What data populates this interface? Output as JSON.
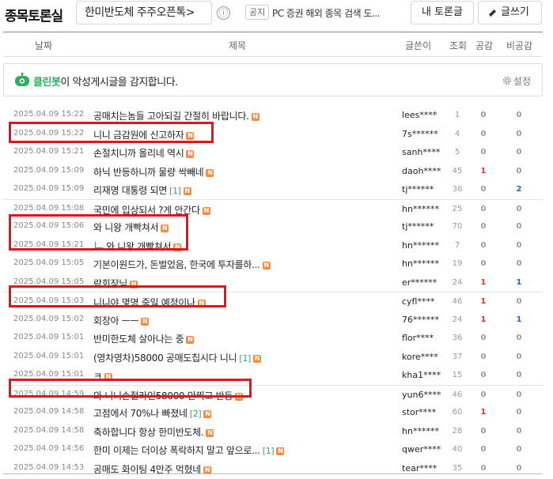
{
  "header": {
    "board_title": "종목토론실",
    "stock_name": "한미반도체 주주오픈톡>",
    "info_icon": "ⓘ",
    "notice_badge": "공지",
    "notice_text": "PC 증권 해외 종목 검색 도...",
    "my_board_button": "내 토론글",
    "write_button": "글쓰기",
    "write_icon": "pencil-icon"
  },
  "columns": {
    "date": "날짜",
    "title": "제목",
    "author": "글쓴이",
    "views": "조회",
    "likes": "공감",
    "dislikes": "비공감"
  },
  "cleanbot": {
    "name": "클린봇",
    "message": "이 악성게시글을 감지합니다.",
    "settings": "설정",
    "accent": "#2ab05e"
  },
  "posts": [
    {
      "date": "2025.04.09 15:22",
      "title": "공매치는놈들 고아되길 간절히 바랍니다.",
      "comments": "",
      "reply": false,
      "author": "lees****",
      "views": "1",
      "likes": "0",
      "dislikes": "0"
    },
    {
      "date": "2025.04.09 15:22",
      "title": "니니 금감원에 신고하자",
      "comments": "",
      "reply": false,
      "author": "7s******",
      "views": "4",
      "likes": "0",
      "dislikes": "0"
    },
    {
      "date": "2025.04.09 15:21",
      "title": "손절치니까 올리네 역시",
      "comments": "",
      "reply": false,
      "author": "sanh****",
      "views": "5",
      "likes": "0",
      "dislikes": "0"
    },
    {
      "date": "2025.04.09 15:09",
      "title": "하닉 반등하니까 물량 싹빼네",
      "comments": "",
      "reply": false,
      "author": "daoh****",
      "views": "45",
      "likes": "1",
      "dislikes": "0"
    },
    {
      "date": "2025.04.09 15:09",
      "title": "리재명 대통령 되면",
      "comments": "[1]",
      "reply": false,
      "author": "tj******",
      "views": "36",
      "likes": "0",
      "dislikes": "2"
    },
    {
      "date": "2025.04.09 15:08",
      "title": "국민에 입상되서 ?게 안간다",
      "comments": "",
      "reply": false,
      "author": "hn******",
      "views": "25",
      "likes": "0",
      "dislikes": "0"
    },
    {
      "date": "2025.04.09 15:06",
      "title": "와 니왕 개빡쳐서",
      "comments": "",
      "reply": false,
      "author": "tj******",
      "views": "70",
      "likes": "0",
      "dislikes": "0"
    },
    {
      "date": "2025.04.09 15:21",
      "title": "와 니왕 개빡쳐서",
      "comments": "",
      "reply": true,
      "author": "hn******",
      "views": "7",
      "likes": "0",
      "dislikes": "0"
    },
    {
      "date": "2025.04.09 15:05",
      "title": "기본이원드가, 돈벌었음, 한국에 투자를하...",
      "comments": "",
      "reply": false,
      "author": "hn******",
      "views": "19",
      "likes": "0",
      "dislikes": "0"
    },
    {
      "date": "2025.04.09 15:05",
      "title": "락회장님",
      "comments": "",
      "reply": false,
      "author": "er******",
      "views": "24",
      "likes": "1",
      "dislikes": "1"
    },
    {
      "date": "2025.04.09 15:03",
      "title": "니니야 몇명 죽일 예정이나",
      "comments": "",
      "reply": false,
      "author": "cyfl****",
      "views": "46",
      "likes": "1",
      "dislikes": "0"
    },
    {
      "date": "2025.04.09 15:02",
      "title": "회장아 ㅡㅡ",
      "comments": "",
      "reply": false,
      "author": "76******",
      "views": "24",
      "likes": "1",
      "dislikes": "1"
    },
    {
      "date": "2025.04.09 15:01",
      "title": "반미한도체 살아나는 중",
      "comments": "",
      "reply": false,
      "author": "flor****",
      "views": "36",
      "likes": "0",
      "dislikes": "0"
    },
    {
      "date": "2025.04.09 15:01",
      "title": "(영차영차)58000 공매도칩시다 니니",
      "comments": "[1]",
      "reply": false,
      "author": "kore****",
      "views": "37",
      "likes": "0",
      "dislikes": "0"
    },
    {
      "date": "2025.04.09 15:01",
      "title": "ㅋ",
      "comments": "",
      "reply": false,
      "author": "kha1****",
      "views": "15",
      "likes": "0",
      "dislikes": "0"
    },
    {
      "date": "2025.04.09 14:59",
      "title": "와 니니손절라인58000 안찍고 반등",
      "comments": "",
      "reply": false,
      "author": "yun6****",
      "views": "46",
      "likes": "0",
      "dislikes": "0"
    },
    {
      "date": "2025.04.09 14:58",
      "title": "고점에서 70%나 빠졌네",
      "comments": "[2]",
      "reply": false,
      "author": "stor****",
      "views": "60",
      "likes": "1",
      "dislikes": "0"
    },
    {
      "date": "2025.04.09 14:58",
      "title": "축하합니다 항상 한미반도체.",
      "comments": "",
      "reply": false,
      "author": "hn******",
      "views": "28",
      "likes": "0",
      "dislikes": "0"
    },
    {
      "date": "2025.04.09 14:56",
      "title": "한미 이제는 더이상 폭락하지 말고 앞으로...",
      "comments": "[1]",
      "reply": false,
      "author": "qwer****",
      "views": "40",
      "likes": "0",
      "dislikes": "0"
    },
    {
      "date": "2025.04.09 14:53",
      "title": "공매도 화이팅 4만주 먹혔네",
      "comments": "",
      "reply": false,
      "author": "tear****",
      "views": "35",
      "likes": "0",
      "dislikes": "0"
    }
  ],
  "new_badge_text": "N",
  "colors": {
    "like_red": "#e0302c",
    "dislike_blue": "#2a64c8",
    "highlight_red": "#e3141b",
    "new_orange": "#ff8a3d"
  }
}
